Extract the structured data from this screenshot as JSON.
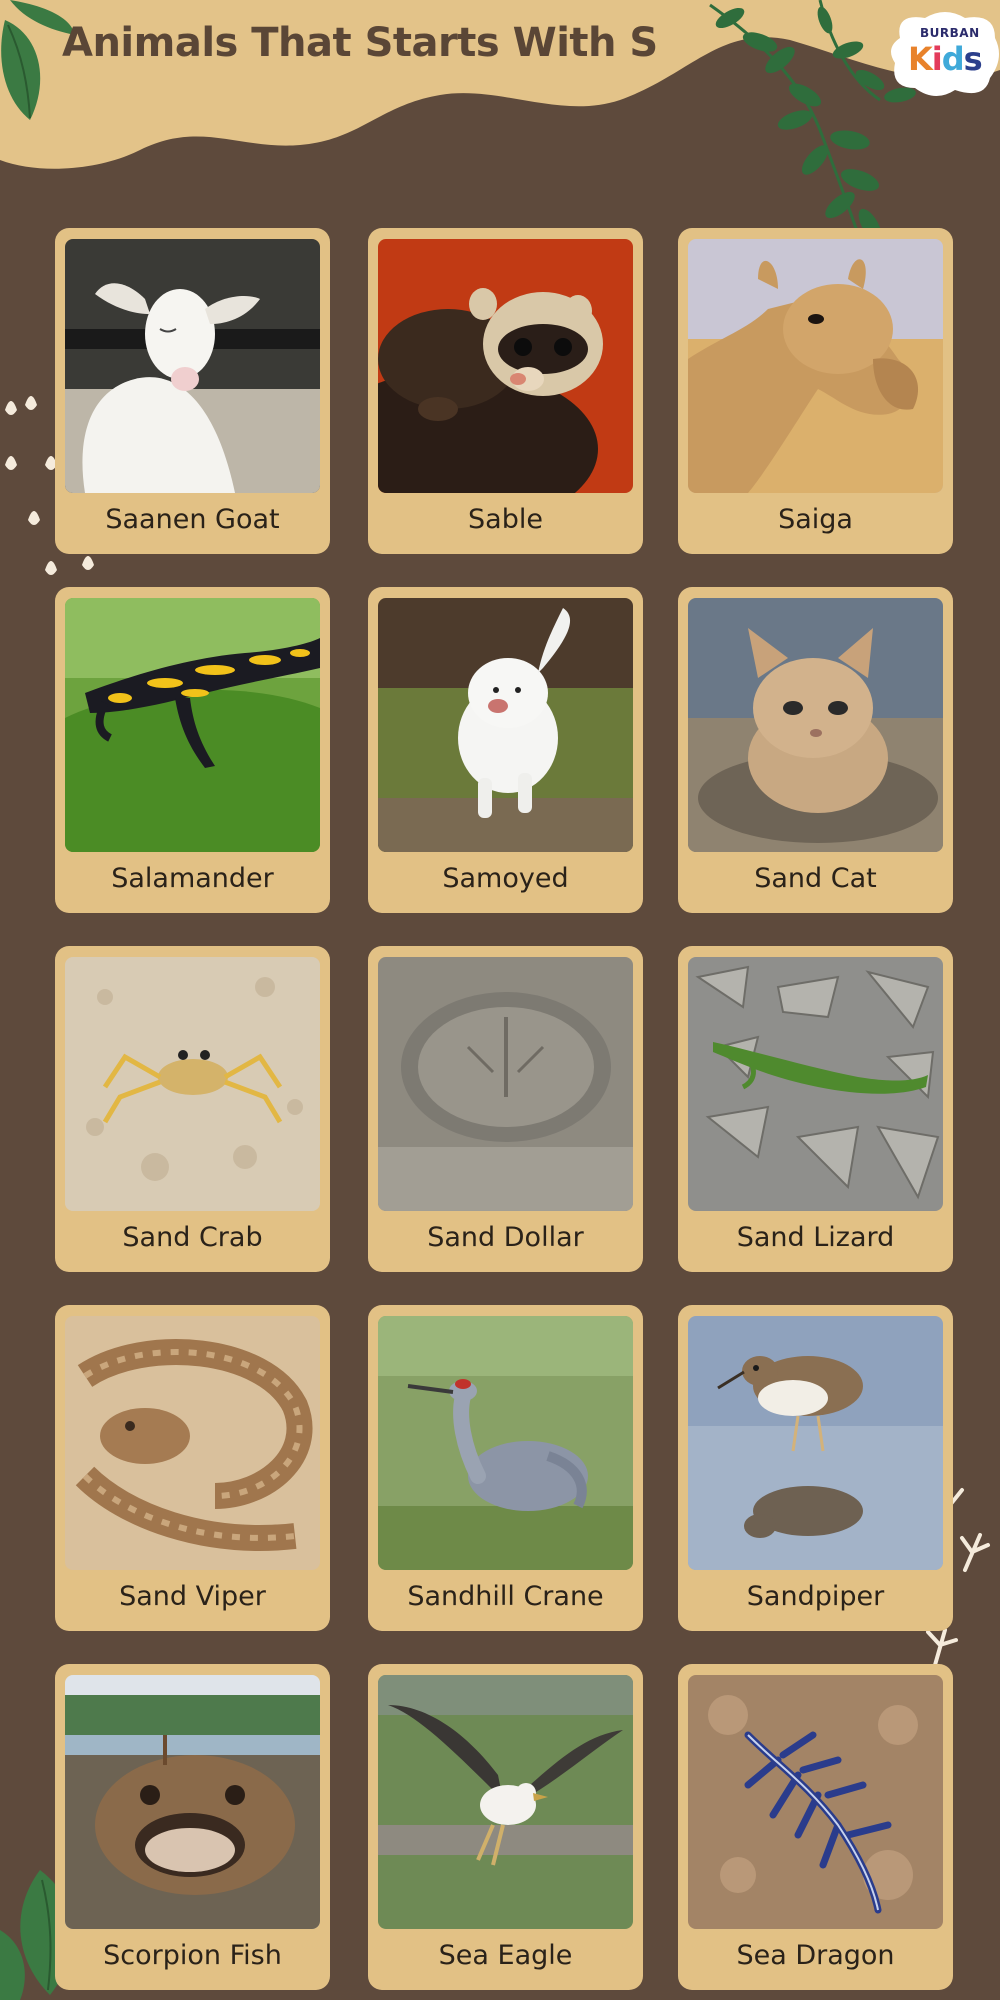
{
  "header": {
    "title": "Animals That Starts With S",
    "logo": {
      "top": "BURBAN",
      "k": "K",
      "i": "i",
      "d": "d",
      "s": "s"
    }
  },
  "colors": {
    "background": "#5e4a3c",
    "banner": "#e3c389",
    "card": "#e2c185",
    "leaf": "#2f6d3c",
    "title": "#5a4636"
  },
  "animals": [
    {
      "label": "Saanen Goat",
      "icon": "goat-photo"
    },
    {
      "label": "Sable",
      "icon": "sable-photo"
    },
    {
      "label": "Saiga",
      "icon": "saiga-photo"
    },
    {
      "label": "Salamander",
      "icon": "salamander-photo"
    },
    {
      "label": "Samoyed",
      "icon": "samoyed-photo"
    },
    {
      "label": "Sand Cat",
      "icon": "sand-cat-photo"
    },
    {
      "label": "Sand Crab",
      "icon": "sand-crab-photo"
    },
    {
      "label": "Sand Dollar",
      "icon": "sand-dollar-photo"
    },
    {
      "label": "Sand Lizard",
      "icon": "sand-lizard-photo"
    },
    {
      "label": "Sand Viper",
      "icon": "sand-viper-photo"
    },
    {
      "label": "Sandhill Crane",
      "icon": "sandhill-crane-photo"
    },
    {
      "label": "Sandpiper",
      "icon": "sandpiper-photo"
    },
    {
      "label": "Scorpion Fish",
      "icon": "scorpion-fish-photo"
    },
    {
      "label": "Sea Eagle",
      "icon": "sea-eagle-photo"
    },
    {
      "label": "Sea Dragon",
      "icon": "sea-dragon-photo"
    }
  ]
}
